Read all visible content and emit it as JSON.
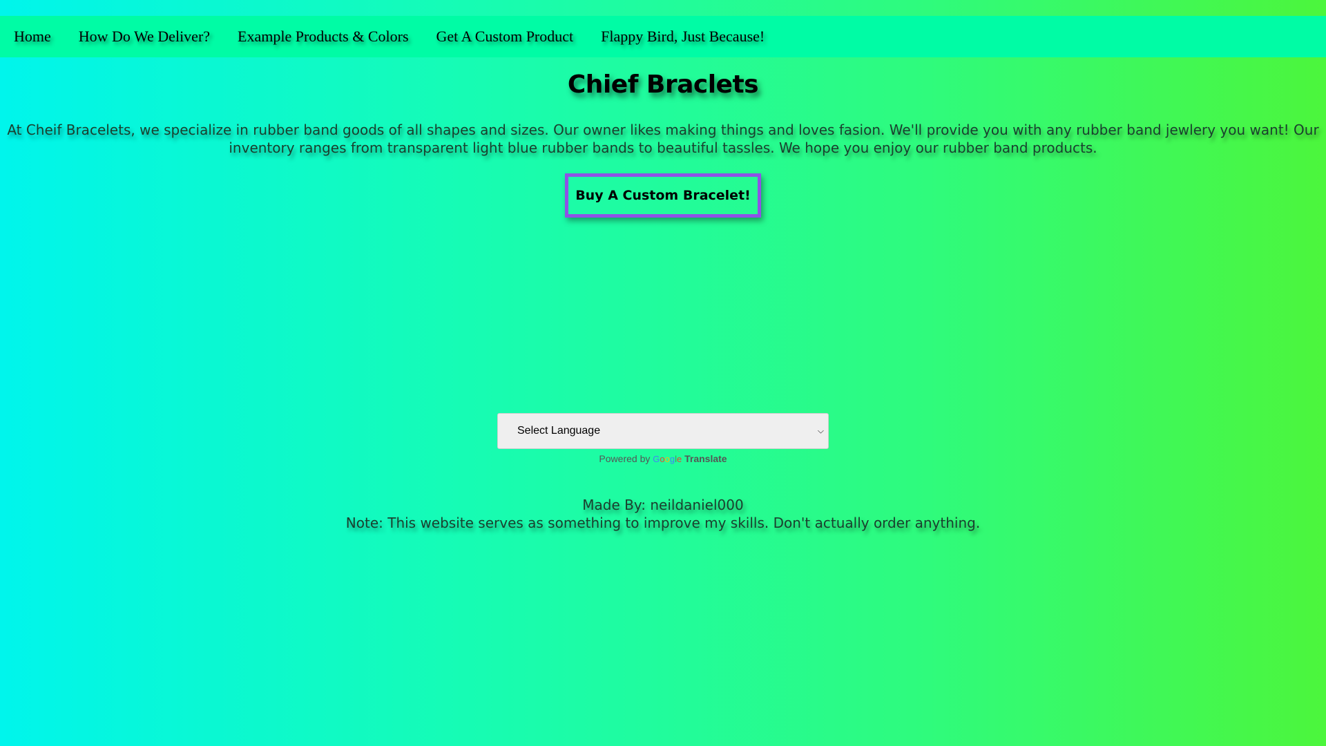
{
  "nav": {
    "items": [
      {
        "label": "Home"
      },
      {
        "label": "How Do We Deliver?"
      },
      {
        "label": "Example Products & Colors"
      },
      {
        "label": "Get A Custom Product"
      },
      {
        "label": "Flappy Bird, Just Because!"
      }
    ]
  },
  "main": {
    "title": "Chief Braclets",
    "description": "At Cheif Bracelets, we specialize in rubber band goods of all shapes and sizes. Our owner likes making things and loves fasion. We'll provide you with any rubber band jewlery you want! Our inventory ranges from transparent light blue rubber bands to beautiful tassles. We hope you enjoy our rubber band products.",
    "buy_button": "Buy A Custom Bracelet!"
  },
  "translate": {
    "select_label": "Select Language",
    "powered_by": "Powered by",
    "google": "Google",
    "translate_label": "Translate"
  },
  "footer": {
    "made_by": "Made By: neildaniel000",
    "note": "Note: This website serves as something to improve my skills. Don't actually order anything."
  },
  "colors": {
    "nav_bar": "#00fca5",
    "button_border": "#8e52e6",
    "gradient_left": "#00f5ec",
    "gradient_right": "#4cf63c"
  },
  "icons": {
    "select_arrow": "chevron-down-icon"
  }
}
